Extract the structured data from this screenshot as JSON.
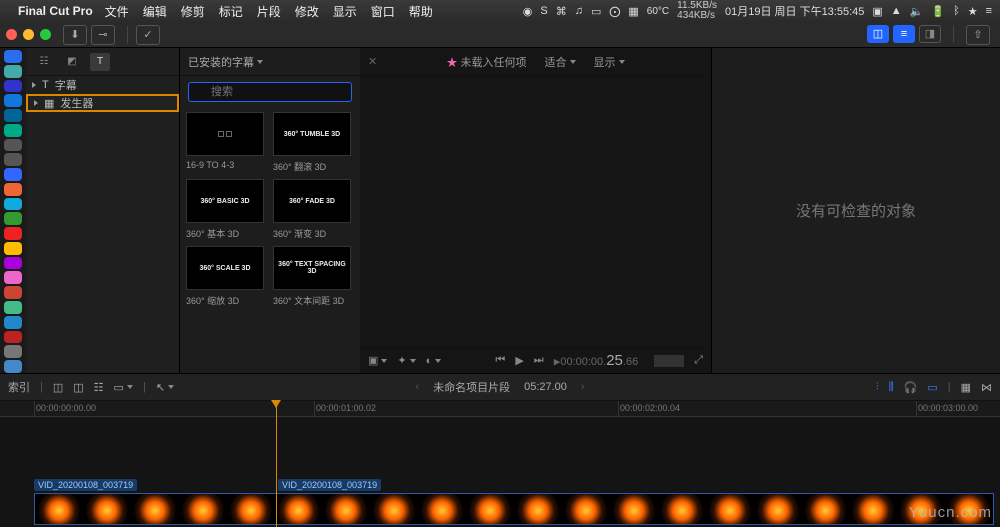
{
  "menubar": {
    "app": "Final Cut Pro",
    "items": [
      "文件",
      "编辑",
      "修剪",
      "标记",
      "片段",
      "修改",
      "显示",
      "窗口",
      "帮助"
    ],
    "status": {
      "temp": "60°C",
      "net_up": "11.5KB/s",
      "net_dn": "434KB/s",
      "date": "01月19日 周日 下午13:55:45"
    }
  },
  "sidebar": {
    "items": [
      {
        "icon": "T",
        "label": "字幕"
      },
      {
        "icon": "▦",
        "label": "发生器"
      }
    ]
  },
  "browser": {
    "filter_label": "已安装的字幕",
    "search_placeholder": "搜索",
    "thumbs": [
      {
        "preview": "squares",
        "label": "16-9 TO 4-3"
      },
      {
        "preview": "360° TUMBLE 3D",
        "label": "360° 翻滚 3D"
      },
      {
        "preview": "360° BASIC 3D",
        "label": "360° 基本 3D"
      },
      {
        "preview": "360° FADE 3D",
        "label": "360° 渐变 3D"
      },
      {
        "preview": "360° SCALE 3D",
        "label": "360° 缩放 3D"
      },
      {
        "preview": "360° TEXT SPACING 3D",
        "label": "360° 文本间距 3D"
      }
    ]
  },
  "viewer": {
    "loaded": "未载入任何项",
    "fit": "适合",
    "view": "显示",
    "tc_prefix": "00:00:00.",
    "tc_frames": "25",
    "tc_suffix": ".66"
  },
  "inspector": {
    "empty": "没有可检查的对象"
  },
  "timeline": {
    "index_label": "索引",
    "project_name": "未命名项目片段",
    "duration": "05:27.00",
    "ruler": [
      "00:00:00:00.00",
      "00:00:01:00.02",
      "00:00:02:00.04",
      "00:00:03:00.00"
    ],
    "clip_name": "VID_20200108_003719"
  },
  "dock_colors": [
    "#2a6ef0",
    "#4aa",
    "#33c",
    "#17d",
    "#069",
    "#0a8",
    "#555",
    "#555",
    "#36f",
    "#e63",
    "#1ad",
    "#393",
    "#e22",
    "#fb0",
    "#a0d",
    "#e6c",
    "#c43",
    "#4b8",
    "#28c",
    "#b22",
    "#777",
    "#48c"
  ],
  "watermark": "Yuucn.com"
}
